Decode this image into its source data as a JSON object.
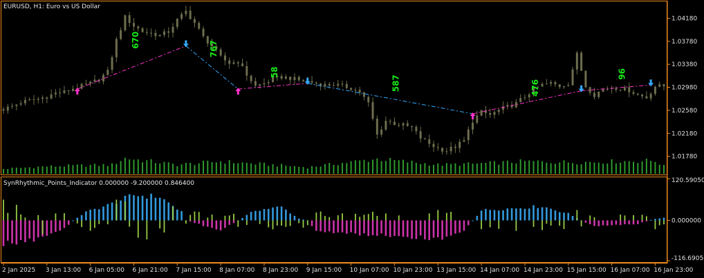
{
  "header": {
    "main_title": "EURUSD, H1:  Euro vs US Dollar",
    "sub_title": "SynRhythmic_Points_Indicator 0.000000 -9.200000 0.846400"
  },
  "colors": {
    "background": "#000000",
    "frame": "#f08a1e",
    "candle": "#6d6d4e",
    "volume": "#2e9a2e",
    "zigzag_up": "#ff33cc",
    "zigzag_down": "#33aaff",
    "osc_blue": "#3399dd",
    "osc_green": "#99cc44",
    "osc_magenta": "#cc33aa",
    "points_text": "#18e818"
  },
  "chart_data": [
    {
      "type": "candlestick",
      "series": "EURUSD H1",
      "ylim": [
        1.015,
        1.0445
      ],
      "price_ticks": [
        "1.04180",
        "1.03780",
        "1.03380",
        "1.02980",
        "1.02580",
        "1.02180",
        "1.01780"
      ],
      "close_path": [
        {
          "t": 0,
          "v": 1.026
        },
        {
          "t": 2,
          "v": 1.0265
        },
        {
          "t": 4,
          "v": 1.0272
        },
        {
          "t": 6,
          "v": 1.0275
        },
        {
          "t": 8,
          "v": 1.0278
        },
        {
          "t": 10,
          "v": 1.0282
        },
        {
          "t": 12,
          "v": 1.0288
        },
        {
          "t": 14,
          "v": 1.029
        },
        {
          "t": 16,
          "v": 1.0296
        },
        {
          "t": 18,
          "v": 1.03
        },
        {
          "t": 20,
          "v": 1.0305
        },
        {
          "t": 22,
          "v": 1.0312
        },
        {
          "t": 24,
          "v": 1.0325
        },
        {
          "t": 26,
          "v": 1.038
        },
        {
          "t": 28,
          "v": 1.042
        },
        {
          "t": 30,
          "v": 1.0405
        },
        {
          "t": 32,
          "v": 1.0395
        },
        {
          "t": 34,
          "v": 1.0392
        },
        {
          "t": 36,
          "v": 1.0388
        },
        {
          "t": 38,
          "v": 1.0395
        },
        {
          "t": 40,
          "v": 1.0415
        },
        {
          "t": 42,
          "v": 1.043
        },
        {
          "t": 44,
          "v": 1.041
        },
        {
          "t": 46,
          "v": 1.0385
        },
        {
          "t": 48,
          "v": 1.037
        },
        {
          "t": 50,
          "v": 1.035
        },
        {
          "t": 52,
          "v": 1.034
        },
        {
          "t": 54,
          "v": 1.0343
        },
        {
          "t": 56,
          "v": 1.032
        },
        {
          "t": 58,
          "v": 1.03
        },
        {
          "t": 60,
          "v": 1.0305
        },
        {
          "t": 62,
          "v": 1.0312
        },
        {
          "t": 64,
          "v": 1.0316
        },
        {
          "t": 66,
          "v": 1.0314
        },
        {
          "t": 68,
          "v": 1.031
        },
        {
          "t": 70,
          "v": 1.0308
        },
        {
          "t": 72,
          "v": 1.0305
        },
        {
          "t": 74,
          "v": 1.0302
        },
        {
          "t": 76,
          "v": 1.0303
        },
        {
          "t": 78,
          "v": 1.03
        },
        {
          "t": 80,
          "v": 1.0297
        },
        {
          "t": 82,
          "v": 1.029
        },
        {
          "t": 84,
          "v": 1.027
        },
        {
          "t": 86,
          "v": 1.0215
        },
        {
          "t": 88,
          "v": 1.024
        },
        {
          "t": 90,
          "v": 1.0235
        },
        {
          "t": 92,
          "v": 1.0232
        },
        {
          "t": 94,
          "v": 1.0228
        },
        {
          "t": 96,
          "v": 1.021
        },
        {
          "t": 98,
          "v": 1.02
        },
        {
          "t": 100,
          "v": 1.0192
        },
        {
          "t": 102,
          "v": 1.0188
        },
        {
          "t": 104,
          "v": 1.0195
        },
        {
          "t": 106,
          "v": 1.0205
        },
        {
          "t": 108,
          "v": 1.024
        },
        {
          "t": 110,
          "v": 1.0255
        },
        {
          "t": 112,
          "v": 1.025
        },
        {
          "t": 114,
          "v": 1.0258
        },
        {
          "t": 116,
          "v": 1.0264
        },
        {
          "t": 118,
          "v": 1.027
        },
        {
          "t": 120,
          "v": 1.0282
        },
        {
          "t": 122,
          "v": 1.0295
        },
        {
          "t": 124,
          "v": 1.0302
        },
        {
          "t": 126,
          "v": 1.0305
        },
        {
          "t": 128,
          "v": 1.03
        },
        {
          "t": 130,
          "v": 1.0305
        },
        {
          "t": 132,
          "v": 1.0355
        },
        {
          "t": 134,
          "v": 1.03
        },
        {
          "t": 136,
          "v": 1.0285
        },
        {
          "t": 138,
          "v": 1.0295
        },
        {
          "t": 140,
          "v": 1.0298
        },
        {
          "t": 142,
          "v": 1.0296
        },
        {
          "t": 144,
          "v": 1.0293
        },
        {
          "t": 146,
          "v": 1.0285
        },
        {
          "t": 148,
          "v": 1.028
        },
        {
          "t": 150,
          "v": 1.03
        },
        {
          "t": 152,
          "v": 1.03
        }
      ],
      "volume_profile": [
        {
          "t": 0,
          "v": 0.3
        },
        {
          "t": 10,
          "v": 0.45
        },
        {
          "t": 25,
          "v": 0.55
        },
        {
          "t": 28,
          "v": 0.95
        },
        {
          "t": 40,
          "v": 0.55
        },
        {
          "t": 50,
          "v": 0.75
        },
        {
          "t": 70,
          "v": 0.4
        },
        {
          "t": 86,
          "v": 0.9
        },
        {
          "t": 100,
          "v": 0.55
        },
        {
          "t": 108,
          "v": 0.6
        },
        {
          "t": 120,
          "v": 0.75
        },
        {
          "t": 132,
          "v": 0.7
        },
        {
          "t": 150,
          "v": 0.8
        },
        {
          "t": 152,
          "v": 0.45
        }
      ],
      "zigzag": [
        {
          "t": 17,
          "v": 1.0295,
          "dir": "up"
        },
        {
          "t": 42,
          "v": 1.037,
          "dir": "down"
        },
        {
          "t": 54,
          "v": 1.0295,
          "dir": "up"
        },
        {
          "t": 70,
          "v": 1.0305,
          "dir": "down"
        },
        {
          "t": 108,
          "v": 1.0252,
          "dir": "up"
        },
        {
          "t": 133,
          "v": 1.0292,
          "dir": "down"
        },
        {
          "t": 149,
          "v": 1.0302,
          "dir": "down"
        }
      ],
      "point_labels": [
        {
          "t": 31,
          "v": 1.0365,
          "text": "670"
        },
        {
          "t": 49,
          "v": 1.035,
          "text": "767"
        },
        {
          "t": 63,
          "v": 1.0314,
          "text": "58"
        },
        {
          "t": 91,
          "v": 1.029,
          "text": "587"
        },
        {
          "t": 123,
          "v": 1.0282,
          "text": "476"
        },
        {
          "t": 143,
          "v": 1.0311,
          "text": "96"
        }
      ]
    },
    {
      "type": "bar",
      "series": "SynRhythmic_Points_Indicator",
      "ylim": [
        -116.6905,
        120.5905
      ],
      "value_ticks": [
        "120.590500",
        "0.000000",
        "-116.690500"
      ],
      "envelope": [
        {
          "t": 0,
          "v": -70
        },
        {
          "t": 8,
          "v": -55
        },
        {
          "t": 14,
          "v": -25
        },
        {
          "t": 16,
          "v": 0
        },
        {
          "t": 19,
          "v": 25
        },
        {
          "t": 24,
          "v": 45
        },
        {
          "t": 30,
          "v": 75
        },
        {
          "t": 36,
          "v": 70
        },
        {
          "t": 41,
          "v": 25
        },
        {
          "t": 42,
          "v": 0
        },
        {
          "t": 46,
          "v": -15
        },
        {
          "t": 50,
          "v": -30
        },
        {
          "t": 54,
          "v": 0
        },
        {
          "t": 58,
          "v": 30
        },
        {
          "t": 64,
          "v": 40
        },
        {
          "t": 68,
          "v": 5
        },
        {
          "t": 70,
          "v": 0
        },
        {
          "t": 72,
          "v": -30
        },
        {
          "t": 80,
          "v": -40
        },
        {
          "t": 90,
          "v": -45
        },
        {
          "t": 100,
          "v": -55
        },
        {
          "t": 106,
          "v": -30
        },
        {
          "t": 108,
          "v": 0
        },
        {
          "t": 110,
          "v": 30
        },
        {
          "t": 116,
          "v": 35
        },
        {
          "t": 124,
          "v": 42
        },
        {
          "t": 130,
          "v": 20
        },
        {
          "t": 133,
          "v": 0
        },
        {
          "t": 136,
          "v": -18
        },
        {
          "t": 146,
          "v": -10
        },
        {
          "t": 150,
          "v": 5
        },
        {
          "t": 152,
          "v": 8
        }
      ],
      "spikes": [
        {
          "t": 0,
          "v": 60
        },
        {
          "t": 3,
          "v": 45
        },
        {
          "t": 9,
          "v": -40
        },
        {
          "t": 12,
          "v": 20
        },
        {
          "t": 20,
          "v": -30
        },
        {
          "t": 26,
          "v": 60
        },
        {
          "t": 28,
          "v": 55
        },
        {
          "t": 31,
          "v": -50
        },
        {
          "t": 33,
          "v": -55
        },
        {
          "t": 37,
          "v": -35
        },
        {
          "t": 39,
          "v": 40
        },
        {
          "t": 47,
          "v": 8
        },
        {
          "t": 61,
          "v": -20
        },
        {
          "t": 63,
          "v": -15
        },
        {
          "t": 85,
          "v": 25
        },
        {
          "t": 88,
          "v": 20
        },
        {
          "t": 98,
          "v": 20
        },
        {
          "t": 100,
          "v": 30
        },
        {
          "t": 103,
          "v": 25
        },
        {
          "t": 112,
          "v": -20
        },
        {
          "t": 118,
          "v": -30
        },
        {
          "t": 124,
          "v": -28
        },
        {
          "t": 129,
          "v": -25
        },
        {
          "t": 132,
          "v": 30
        }
      ]
    }
  ],
  "time_axis": [
    {
      "t": 0,
      "label": "2 Jan 2025"
    },
    {
      "t": 10,
      "label": "3 Jan 13:00"
    },
    {
      "t": 20,
      "label": "6 Jan 05:00"
    },
    {
      "t": 30,
      "label": "6 Jan 21:00"
    },
    {
      "t": 40,
      "label": "7 Jan 15:00"
    },
    {
      "t": 50,
      "label": "8 Jan 07:00"
    },
    {
      "t": 60,
      "label": "8 Jan 23:00"
    },
    {
      "t": 70,
      "label": "9 Jan 15:00"
    },
    {
      "t": 80,
      "label": "10 Jan 07:00"
    },
    {
      "t": 90,
      "label": "10 Jan 23:00"
    },
    {
      "t": 100,
      "label": "13 Jan 15:00"
    },
    {
      "t": 110,
      "label": "14 Jan 07:00"
    },
    {
      "t": 120,
      "label": "14 Jan 23:00"
    },
    {
      "t": 130,
      "label": "15 Jan 15:00"
    },
    {
      "t": 140,
      "label": "16 Jan 07:00"
    },
    {
      "t": 150,
      "label": "16 Jan 23:00"
    }
  ]
}
